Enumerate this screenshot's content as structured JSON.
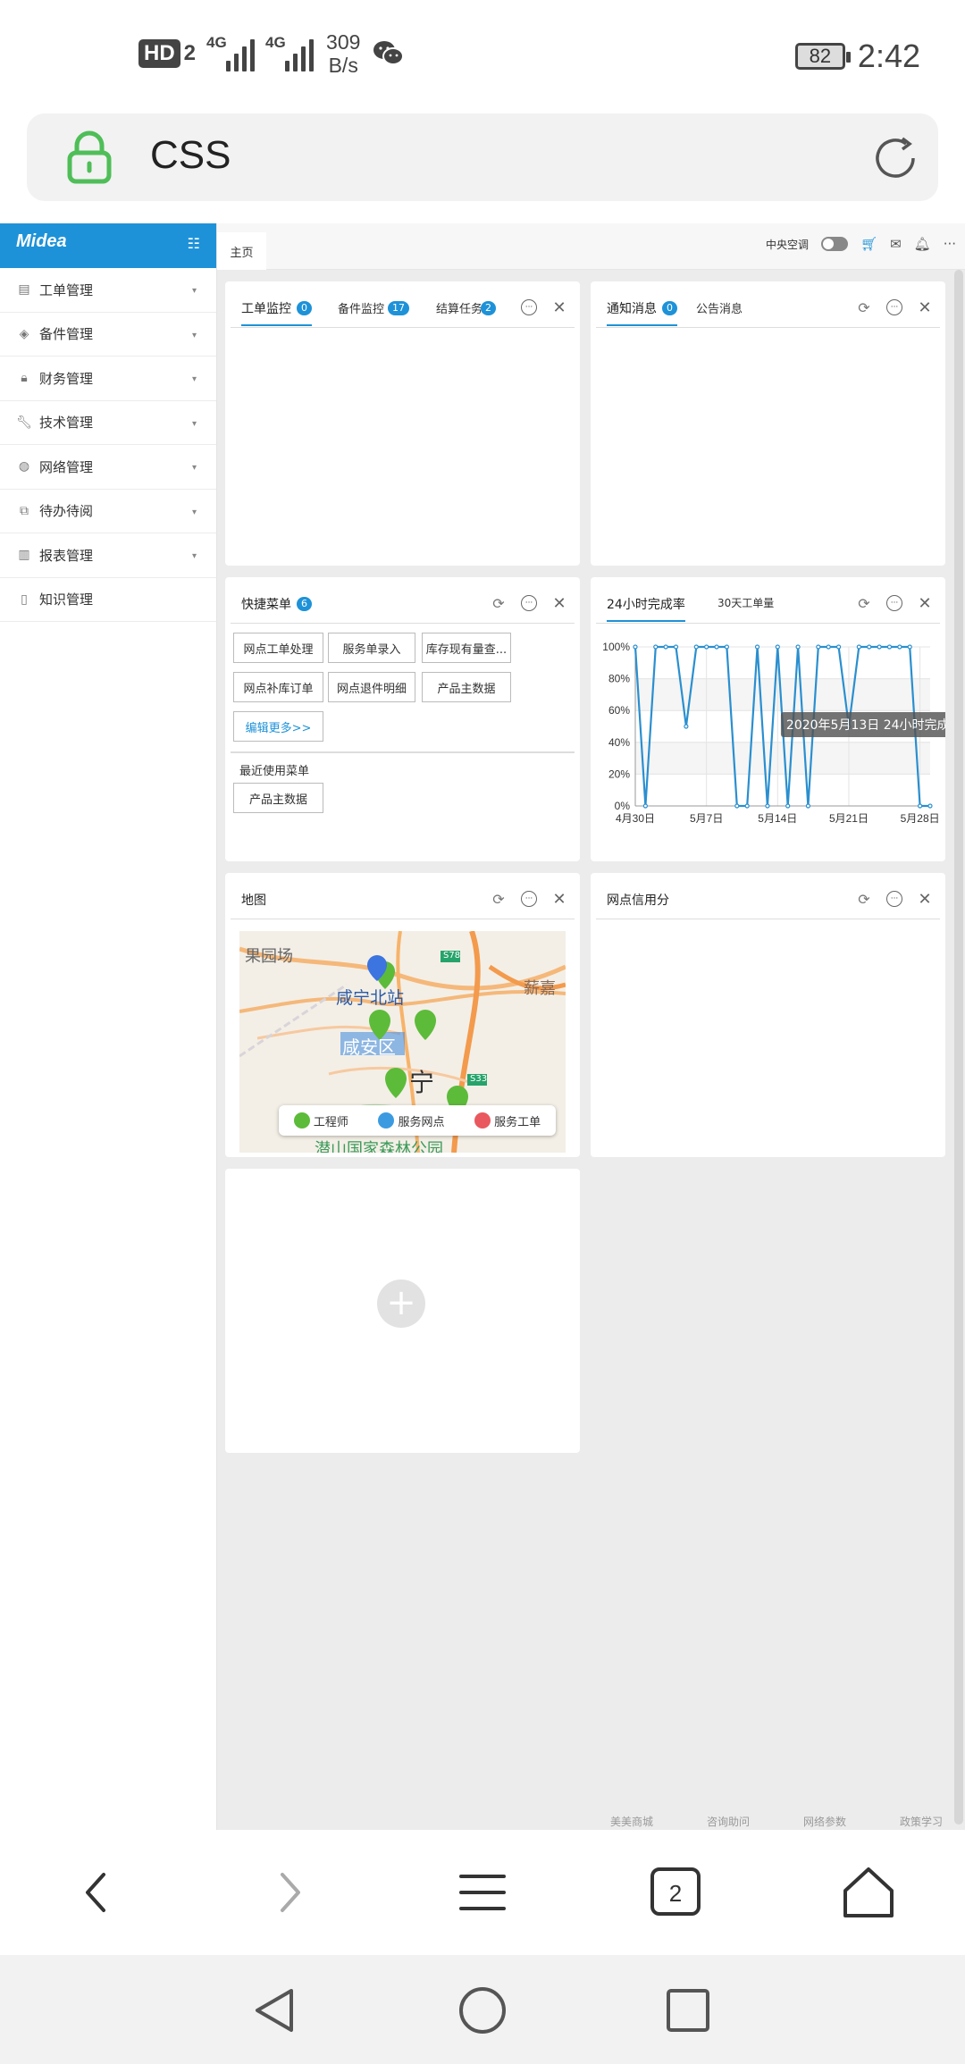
{
  "status_bar": {
    "hd_label": "HD",
    "hd_sub": "2",
    "signal1_label": "4G",
    "signal2_label": "4G",
    "speed_value": "309",
    "speed_unit": "B/s",
    "battery": "82",
    "time": "2:42"
  },
  "url_bar": {
    "url": "CSS"
  },
  "app": {
    "brand": "Midea",
    "accent_color": "#1e92d8",
    "menu": [
      {
        "label": "工单管理",
        "icon": "clipboard-icon",
        "has_caret": true
      },
      {
        "label": "备件管理",
        "icon": "layers-icon",
        "has_caret": true
      },
      {
        "label": "财务管理",
        "icon": "lock-icon",
        "has_caret": true
      },
      {
        "label": "技术管理",
        "icon": "wrench-icon",
        "has_caret": true
      },
      {
        "label": "网络管理",
        "icon": "palette-icon",
        "has_caret": true
      },
      {
        "label": "待办待阅",
        "icon": "flow-icon",
        "has_caret": true
      },
      {
        "label": "报表管理",
        "icon": "bar-chart-icon",
        "has_caret": true
      },
      {
        "label": "知识管理",
        "icon": "book-icon",
        "has_caret": false
      }
    ],
    "tab_home": "主页",
    "topbar_toggle_label": "中央空调",
    "topbar_more": "···"
  },
  "cards": {
    "workorder": {
      "tabs": [
        {
          "label": "工单监控",
          "badge": "0"
        },
        {
          "label": "备件监控",
          "badge": "17"
        },
        {
          "label": "结算任务",
          "badge": "2"
        }
      ]
    },
    "notice": {
      "tabs": [
        {
          "label": "通知消息",
          "badge": "0"
        },
        {
          "label": "公告消息"
        }
      ]
    },
    "quickmenu": {
      "title": "快捷菜单",
      "badge": "6",
      "buttons": [
        "网点工单处理",
        "服务单录入",
        "库存现有量查...",
        "网点补库订单",
        "网点退件明细",
        "产品主数据"
      ],
      "edit_more": "编辑更多>>",
      "recent_title": "最近使用菜单",
      "recent_buttons": [
        "产品主数据"
      ]
    },
    "completion": {
      "tabs": [
        "24小时完成率",
        "30天工单量"
      ]
    },
    "map": {
      "title": "地图",
      "place_labels": [
        "果园场",
        "咸宁北站",
        "咸安区",
        "宁",
        "薪嘉",
        "潜山国家森林公园"
      ],
      "road_labels": [
        "S78",
        "S33"
      ],
      "legend": [
        {
          "label": "工程师",
          "color": "#5dbb3a"
        },
        {
          "label": "服务网点",
          "color": "#3c9be0"
        },
        {
          "label": "服务工单",
          "color": "#e9585e"
        }
      ]
    },
    "credit": {
      "title": "网点信用分"
    }
  },
  "footer_links": [
    "美美商城",
    "咨询助问",
    "网络参数",
    "政策学习"
  ],
  "chart_data": {
    "type": "line",
    "title": "",
    "xlabel": "",
    "ylabel": "",
    "x_tick_labels": [
      "4月30日",
      "5月7日",
      "5月14日",
      "5月21日",
      "5月28日"
    ],
    "y_tick_labels": [
      "0%",
      "20%",
      "40%",
      "60%",
      "80%",
      "100%"
    ],
    "ylim": [
      0,
      100
    ],
    "grid": true,
    "tooltip": "2020年5月13日 24小时完成",
    "series": [
      {
        "color": "#2a8fcf",
        "x": [
          "4月30日",
          "5月1日",
          "5月2日",
          "5月3日",
          "5月4日",
          "5月5日",
          "5月6日",
          "5月7日",
          "5月8日",
          "5月9日",
          "5月10日",
          "5月11日",
          "5月12日",
          "5月13日",
          "5月14日",
          "5月15日",
          "5月16日",
          "5月17日",
          "5月18日",
          "5月19日",
          "5月20日",
          "5月21日",
          "5月22日",
          "5月23日",
          "5月24日",
          "5月25日",
          "5月26日",
          "5月27日",
          "5月28日",
          "5月29日"
        ],
        "values": [
          100,
          0,
          100,
          100,
          100,
          50,
          100,
          100,
          100,
          100,
          0,
          0,
          100,
          0,
          100,
          0,
          100,
          0,
          100,
          100,
          100,
          50,
          100,
          100,
          100,
          100,
          100,
          100,
          0,
          0
        ]
      }
    ]
  }
}
